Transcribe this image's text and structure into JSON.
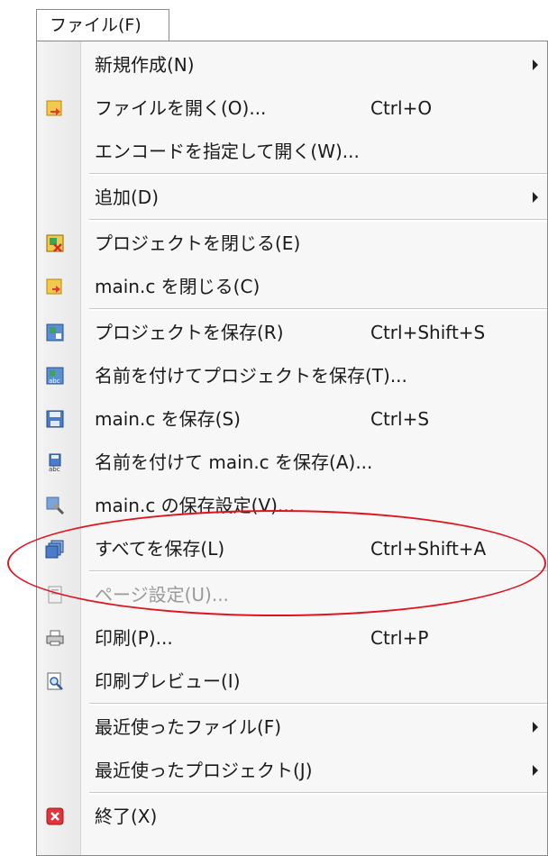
{
  "menu_title": "ファイル(F)",
  "items": [
    {
      "label": "新規作成(N)",
      "shortcut": "",
      "submenu": true,
      "icon": "none"
    },
    {
      "label": "ファイルを開く(O)...",
      "shortcut": "Ctrl+O",
      "submenu": false,
      "icon": "open-file-icon"
    },
    {
      "label": "エンコードを指定して開く(W)...",
      "shortcut": "",
      "submenu": false,
      "icon": "none"
    },
    {
      "label": "追加(D)",
      "shortcut": "",
      "submenu": true,
      "icon": "none"
    },
    {
      "label": "プロジェクトを閉じる(E)",
      "shortcut": "",
      "submenu": false,
      "icon": "close-project-icon"
    },
    {
      "label": "main.c を閉じる(C)",
      "shortcut": "",
      "submenu": false,
      "icon": "close-file-icon"
    },
    {
      "label": "プロジェクトを保存(R)",
      "shortcut": "Ctrl+Shift+S",
      "submenu": false,
      "icon": "save-project-icon"
    },
    {
      "label": "名前を付けてプロジェクトを保存(T)...",
      "shortcut": "",
      "submenu": false,
      "icon": "save-project-as-icon"
    },
    {
      "label": "main.c を保存(S)",
      "shortcut": "Ctrl+S",
      "submenu": false,
      "icon": "save-icon"
    },
    {
      "label": "名前を付けて main.c を保存(A)...",
      "shortcut": "",
      "submenu": false,
      "icon": "save-as-icon"
    },
    {
      "label": "main.c の保存設定(V)...",
      "shortcut": "",
      "submenu": false,
      "icon": "save-settings-icon"
    },
    {
      "label": "すべてを保存(L)",
      "shortcut": "Ctrl+Shift+A",
      "submenu": false,
      "icon": "save-all-icon"
    },
    {
      "label": "ページ設定(U)...",
      "shortcut": "",
      "submenu": false,
      "icon": "page-setup-icon",
      "disabled": true
    },
    {
      "label": "印刷(P)...",
      "shortcut": "Ctrl+P",
      "submenu": false,
      "icon": "print-icon"
    },
    {
      "label": "印刷プレビュー(I)",
      "shortcut": "",
      "submenu": false,
      "icon": "print-preview-icon"
    },
    {
      "label": "最近使ったファイル(F)",
      "shortcut": "",
      "submenu": true,
      "icon": "none"
    },
    {
      "label": "最近使ったプロジェクト(J)",
      "shortcut": "",
      "submenu": true,
      "icon": "none"
    },
    {
      "label": "終了(X)",
      "shortcut": "",
      "submenu": false,
      "icon": "exit-icon"
    }
  ],
  "colors": {
    "highlight_ellipse": "#e0141e",
    "menu_bg": "#f7f7f7"
  }
}
